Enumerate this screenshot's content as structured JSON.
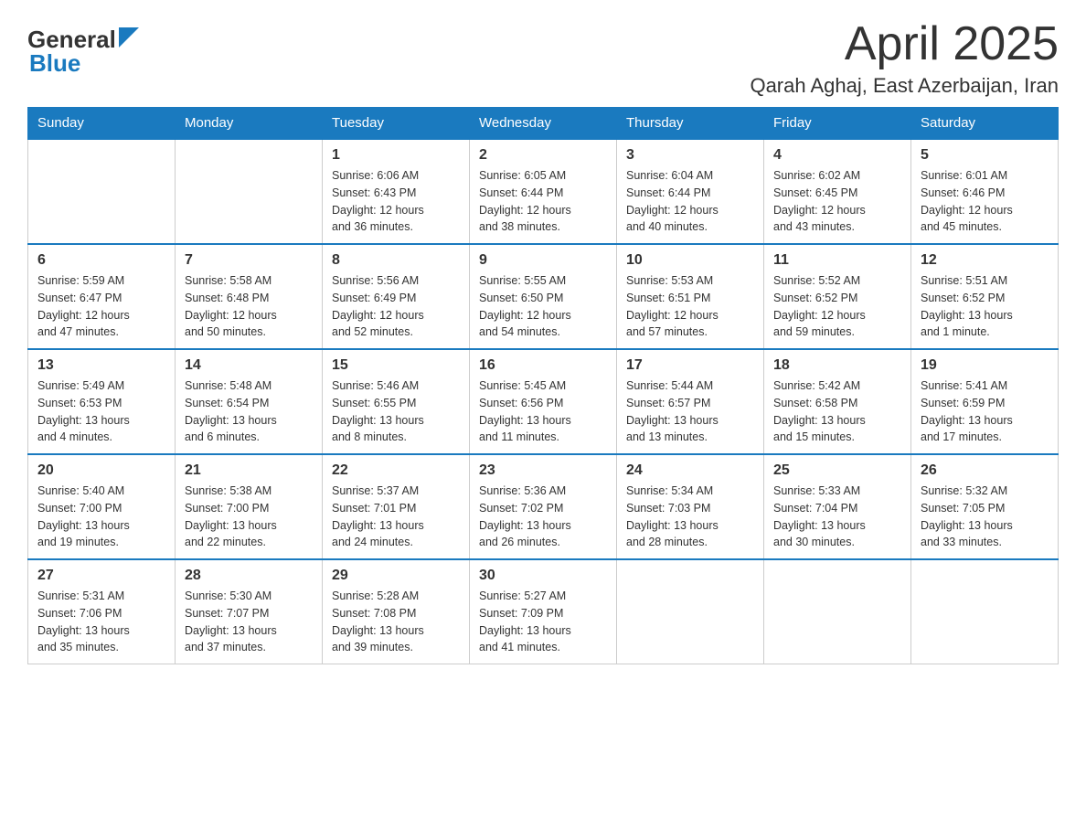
{
  "header": {
    "logo_general": "General",
    "logo_blue": "Blue",
    "title": "April 2025",
    "subtitle": "Qarah Aghaj, East Azerbaijan, Iran"
  },
  "days_of_week": [
    "Sunday",
    "Monday",
    "Tuesday",
    "Wednesday",
    "Thursday",
    "Friday",
    "Saturday"
  ],
  "weeks": [
    [
      {
        "day": "",
        "info": ""
      },
      {
        "day": "",
        "info": ""
      },
      {
        "day": "1",
        "info": "Sunrise: 6:06 AM\nSunset: 6:43 PM\nDaylight: 12 hours\nand 36 minutes."
      },
      {
        "day": "2",
        "info": "Sunrise: 6:05 AM\nSunset: 6:44 PM\nDaylight: 12 hours\nand 38 minutes."
      },
      {
        "day": "3",
        "info": "Sunrise: 6:04 AM\nSunset: 6:44 PM\nDaylight: 12 hours\nand 40 minutes."
      },
      {
        "day": "4",
        "info": "Sunrise: 6:02 AM\nSunset: 6:45 PM\nDaylight: 12 hours\nand 43 minutes."
      },
      {
        "day": "5",
        "info": "Sunrise: 6:01 AM\nSunset: 6:46 PM\nDaylight: 12 hours\nand 45 minutes."
      }
    ],
    [
      {
        "day": "6",
        "info": "Sunrise: 5:59 AM\nSunset: 6:47 PM\nDaylight: 12 hours\nand 47 minutes."
      },
      {
        "day": "7",
        "info": "Sunrise: 5:58 AM\nSunset: 6:48 PM\nDaylight: 12 hours\nand 50 minutes."
      },
      {
        "day": "8",
        "info": "Sunrise: 5:56 AM\nSunset: 6:49 PM\nDaylight: 12 hours\nand 52 minutes."
      },
      {
        "day": "9",
        "info": "Sunrise: 5:55 AM\nSunset: 6:50 PM\nDaylight: 12 hours\nand 54 minutes."
      },
      {
        "day": "10",
        "info": "Sunrise: 5:53 AM\nSunset: 6:51 PM\nDaylight: 12 hours\nand 57 minutes."
      },
      {
        "day": "11",
        "info": "Sunrise: 5:52 AM\nSunset: 6:52 PM\nDaylight: 12 hours\nand 59 minutes."
      },
      {
        "day": "12",
        "info": "Sunrise: 5:51 AM\nSunset: 6:52 PM\nDaylight: 13 hours\nand 1 minute."
      }
    ],
    [
      {
        "day": "13",
        "info": "Sunrise: 5:49 AM\nSunset: 6:53 PM\nDaylight: 13 hours\nand 4 minutes."
      },
      {
        "day": "14",
        "info": "Sunrise: 5:48 AM\nSunset: 6:54 PM\nDaylight: 13 hours\nand 6 minutes."
      },
      {
        "day": "15",
        "info": "Sunrise: 5:46 AM\nSunset: 6:55 PM\nDaylight: 13 hours\nand 8 minutes."
      },
      {
        "day": "16",
        "info": "Sunrise: 5:45 AM\nSunset: 6:56 PM\nDaylight: 13 hours\nand 11 minutes."
      },
      {
        "day": "17",
        "info": "Sunrise: 5:44 AM\nSunset: 6:57 PM\nDaylight: 13 hours\nand 13 minutes."
      },
      {
        "day": "18",
        "info": "Sunrise: 5:42 AM\nSunset: 6:58 PM\nDaylight: 13 hours\nand 15 minutes."
      },
      {
        "day": "19",
        "info": "Sunrise: 5:41 AM\nSunset: 6:59 PM\nDaylight: 13 hours\nand 17 minutes."
      }
    ],
    [
      {
        "day": "20",
        "info": "Sunrise: 5:40 AM\nSunset: 7:00 PM\nDaylight: 13 hours\nand 19 minutes."
      },
      {
        "day": "21",
        "info": "Sunrise: 5:38 AM\nSunset: 7:00 PM\nDaylight: 13 hours\nand 22 minutes."
      },
      {
        "day": "22",
        "info": "Sunrise: 5:37 AM\nSunset: 7:01 PM\nDaylight: 13 hours\nand 24 minutes."
      },
      {
        "day": "23",
        "info": "Sunrise: 5:36 AM\nSunset: 7:02 PM\nDaylight: 13 hours\nand 26 minutes."
      },
      {
        "day": "24",
        "info": "Sunrise: 5:34 AM\nSunset: 7:03 PM\nDaylight: 13 hours\nand 28 minutes."
      },
      {
        "day": "25",
        "info": "Sunrise: 5:33 AM\nSunset: 7:04 PM\nDaylight: 13 hours\nand 30 minutes."
      },
      {
        "day": "26",
        "info": "Sunrise: 5:32 AM\nSunset: 7:05 PM\nDaylight: 13 hours\nand 33 minutes."
      }
    ],
    [
      {
        "day": "27",
        "info": "Sunrise: 5:31 AM\nSunset: 7:06 PM\nDaylight: 13 hours\nand 35 minutes."
      },
      {
        "day": "28",
        "info": "Sunrise: 5:30 AM\nSunset: 7:07 PM\nDaylight: 13 hours\nand 37 minutes."
      },
      {
        "day": "29",
        "info": "Sunrise: 5:28 AM\nSunset: 7:08 PM\nDaylight: 13 hours\nand 39 minutes."
      },
      {
        "day": "30",
        "info": "Sunrise: 5:27 AM\nSunset: 7:09 PM\nDaylight: 13 hours\nand 41 minutes."
      },
      {
        "day": "",
        "info": ""
      },
      {
        "day": "",
        "info": ""
      },
      {
        "day": "",
        "info": ""
      }
    ]
  ]
}
